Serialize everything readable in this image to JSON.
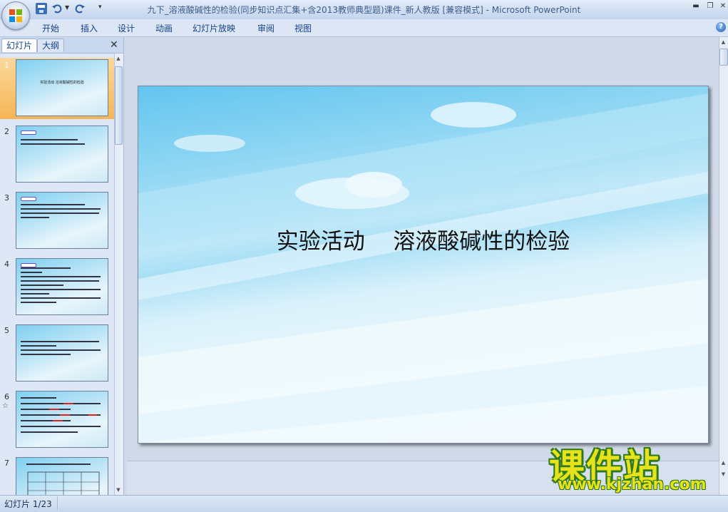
{
  "window": {
    "title_doc": "九下_溶液酸碱性的检验(同步知识点汇集+含2013教师典型题)课件_新人教版 [兼容模式]",
    "title_sep": " - ",
    "title_app": "Microsoft PowerPoint"
  },
  "ribbon": {
    "tabs": [
      "开始",
      "插入",
      "设计",
      "动画",
      "幻灯片放映",
      "审阅",
      "视图"
    ]
  },
  "panel": {
    "tabs": [
      "幻灯片",
      "大纲"
    ],
    "close_glyph": "✕",
    "thumbnails": [
      {
        "num": "1",
        "title": "实验活动   溶液酸碱性的检验"
      },
      {
        "num": "2"
      },
      {
        "num": "3"
      },
      {
        "num": "4"
      },
      {
        "num": "5"
      },
      {
        "num": "6"
      },
      {
        "num": "7"
      }
    ]
  },
  "slide": {
    "title": "实验活动    溶液酸碱性的检验"
  },
  "status": {
    "text": "幻灯片 1/23"
  },
  "watermark": {
    "cn": "课件站",
    "url": "www.kjzhan.com"
  },
  "colors": {
    "accent": "#15428b",
    "selected": "#f5b556",
    "watermark_fill": "#e7e21a",
    "watermark_outline": "#2f7a1e"
  }
}
